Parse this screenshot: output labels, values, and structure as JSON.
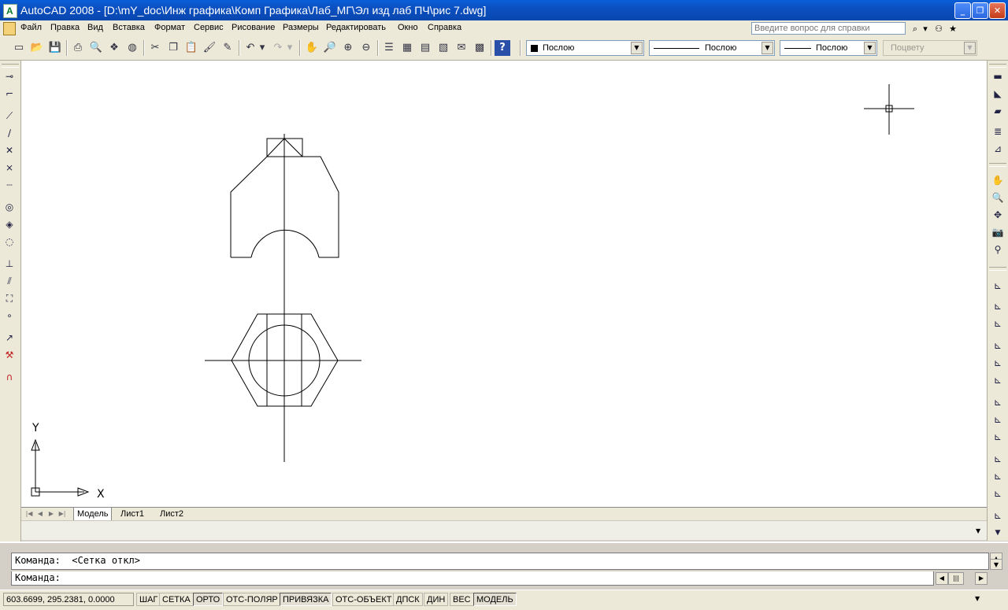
{
  "window": {
    "title": "AutoCAD 2008 - [D:\\mY_doc\\Инж графика\\Комп Графика\\Лаб_МГ\\Эл изд лаб ПЧ\\рис 7.dwg]",
    "minimize_icon": "minimize-icon",
    "restore_icon": "restore-icon",
    "close_icon": "close-icon"
  },
  "menu": {
    "items": [
      "Файл",
      "Правка",
      "Вид",
      "Вставка",
      "Формат",
      "Сервис",
      "Рисование",
      "Размеры",
      "Редактировать",
      "Окно",
      "Справка"
    ],
    "help_placeholder": "Введите вопрос для справки"
  },
  "toolbar": {
    "buttons": [
      "new-file-icon",
      "open-file-icon",
      "save-icon",
      "plot-icon",
      "plot-preview-icon",
      "publish-icon",
      "3d-dwf-icon",
      "cut-icon",
      "copy-icon",
      "paste-icon",
      "match-properties-icon",
      "block-editor-icon",
      "undo-icon",
      "redo-icon",
      "pan-icon",
      "zoom-realtime-icon",
      "zoom-window-icon",
      "zoom-previous-icon",
      "properties-icon",
      "design-center-icon",
      "tool-palettes-icon",
      "sheet-set-icon",
      "markup-icon",
      "quickcalc-icon",
      "help-icon"
    ],
    "color_value": "Послою",
    "linetype_value": "Послою",
    "lineweight_value": "Послою",
    "plotstyle_value": "Поцвету"
  },
  "layout_tabs": [
    "Модель",
    "Лист1",
    "Лист2"
  ],
  "ucs": {
    "x_label": "X",
    "y_label": "Y"
  },
  "command": {
    "history_line": "Команда:  <Сетка откл>",
    "prompt": "Команда:"
  },
  "status": {
    "coordinates": "603.6699, 295.2381, 0.0000",
    "toggles": [
      {
        "label": "ШАГ",
        "on": false
      },
      {
        "label": "СЕТКА",
        "on": false
      },
      {
        "label": "ОРТО",
        "on": true
      },
      {
        "label": "ОТС-ПОЛЯР",
        "on": false
      },
      {
        "label": "ПРИВЯЗКА",
        "on": true
      },
      {
        "label": "ОТС-ОБЪЕКТ",
        "on": false
      },
      {
        "label": "ДПСК",
        "on": false
      },
      {
        "label": "ДИН",
        "on": false
      },
      {
        "label": "ВЕС",
        "on": false
      },
      {
        "label": "МОДЕЛЬ",
        "on": true
      }
    ]
  },
  "colors": {
    "titlebar": "#0a5fd8",
    "canvas": "#ffffff",
    "chrome": "#ece9d8"
  }
}
